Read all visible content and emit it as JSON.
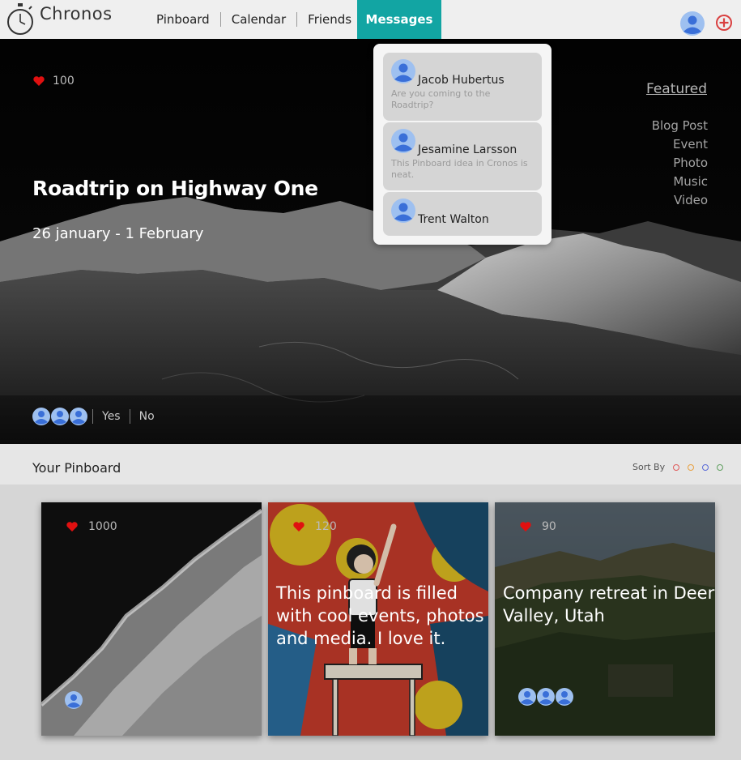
{
  "app": {
    "brand": "Chronos"
  },
  "nav": {
    "items": [
      "Pinboard",
      "Calendar",
      "Friends"
    ],
    "active": "Messages"
  },
  "hero": {
    "likes": "100",
    "title": "Roadtrip on Highway One",
    "dates": "26 january - 1 February",
    "featured": "Featured",
    "categories": [
      "Blog Post",
      "Event",
      "Photo",
      "Music",
      "Video"
    ],
    "rsvp_yes": "Yes",
    "rsvp_no": "No"
  },
  "messages": [
    {
      "name": "Jacob Hubertus",
      "preview": "Are you coming to the Roadtrip?"
    },
    {
      "name": "Jesamine Larsson",
      "preview": "This Pinboard idea in Cronos is neat."
    },
    {
      "name": "Trent Walton",
      "preview": ""
    }
  ],
  "pinboard": {
    "title": "Your Pinboard",
    "sort_label": "Sort By",
    "sort_colors": [
      "#e05a5a",
      "#e8a040",
      "#5a6ad8",
      "#60a060"
    ],
    "cards": [
      {
        "likes": "1000",
        "text": ""
      },
      {
        "likes": "120",
        "text": "This pinboard is filled with cool events, photos and media. I love it."
      },
      {
        "likes": "90",
        "text": "Company retreat in Deer Valley, Utah"
      }
    ]
  },
  "colors": {
    "accent": "#12a5a3",
    "heart": "#e01010",
    "add": "#d94040"
  }
}
